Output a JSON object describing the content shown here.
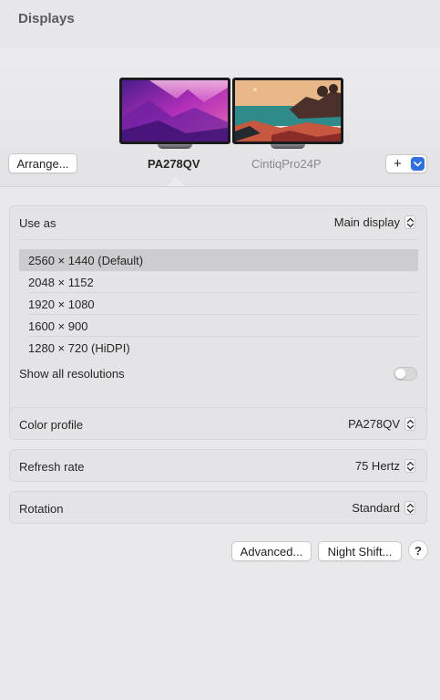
{
  "window": {
    "title": "Displays"
  },
  "displays": [
    {
      "name": "PA278QV",
      "selected": true
    },
    {
      "name": "CintiqPro24P",
      "selected": false
    }
  ],
  "header": {
    "arrange_label": "Arrange...",
    "add_label": "+",
    "add_dropdown_icon": "chevron-down-icon"
  },
  "use_as": {
    "label": "Use as",
    "value": "Main display"
  },
  "resolutions": {
    "items": [
      "2560 × 1440 (Default)",
      "2048 × 1152",
      "1920 × 1080",
      "1600 × 900",
      "1280 × 720 (HiDPI)"
    ],
    "selected_index": 0,
    "show_all_label": "Show all resolutions",
    "show_all_enabled": false
  },
  "color_profile": {
    "label": "Color profile",
    "value": "PA278QV"
  },
  "refresh_rate": {
    "label": "Refresh rate",
    "value": "75 Hertz"
  },
  "rotation": {
    "label": "Rotation",
    "value": "Standard"
  },
  "footer": {
    "advanced_label": "Advanced...",
    "night_shift_label": "Night Shift...",
    "help_label": "?"
  },
  "colors": {
    "accent": "#2f6fe4",
    "background": "#e9e9eb",
    "group_background": "#e4e4e6",
    "selected_row": "#cdcdcf"
  }
}
